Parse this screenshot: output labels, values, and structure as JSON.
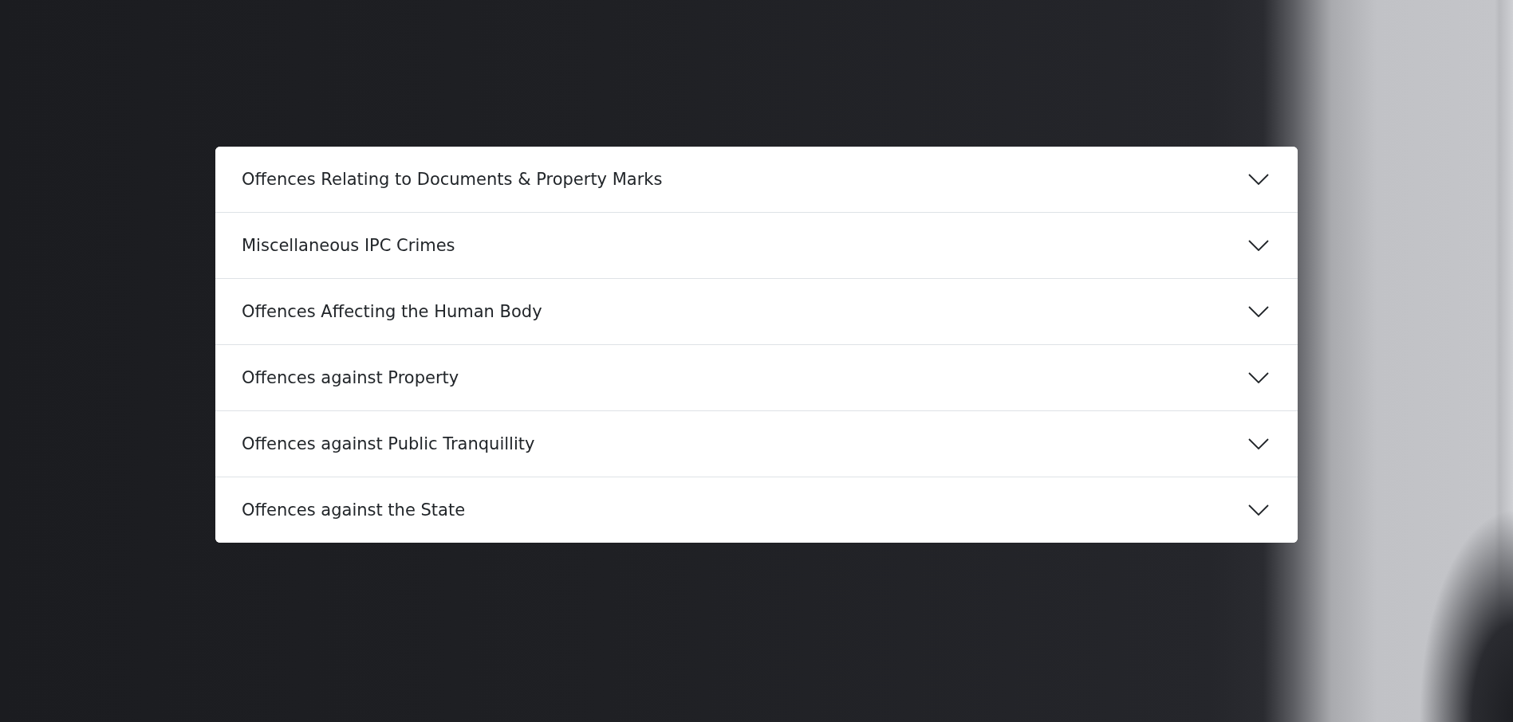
{
  "accordion": {
    "items": [
      {
        "title": "Offences Relating to Documents & Property Marks",
        "expanded": false
      },
      {
        "title": "Miscellaneous IPC Crimes",
        "expanded": false
      },
      {
        "title": "Offences Affecting the Human Body",
        "expanded": false
      },
      {
        "title": "Offences against Property",
        "expanded": false
      },
      {
        "title": "Offences against Public Tranquillity",
        "expanded": false
      },
      {
        "title": "Offences against the State",
        "expanded": false
      }
    ]
  }
}
